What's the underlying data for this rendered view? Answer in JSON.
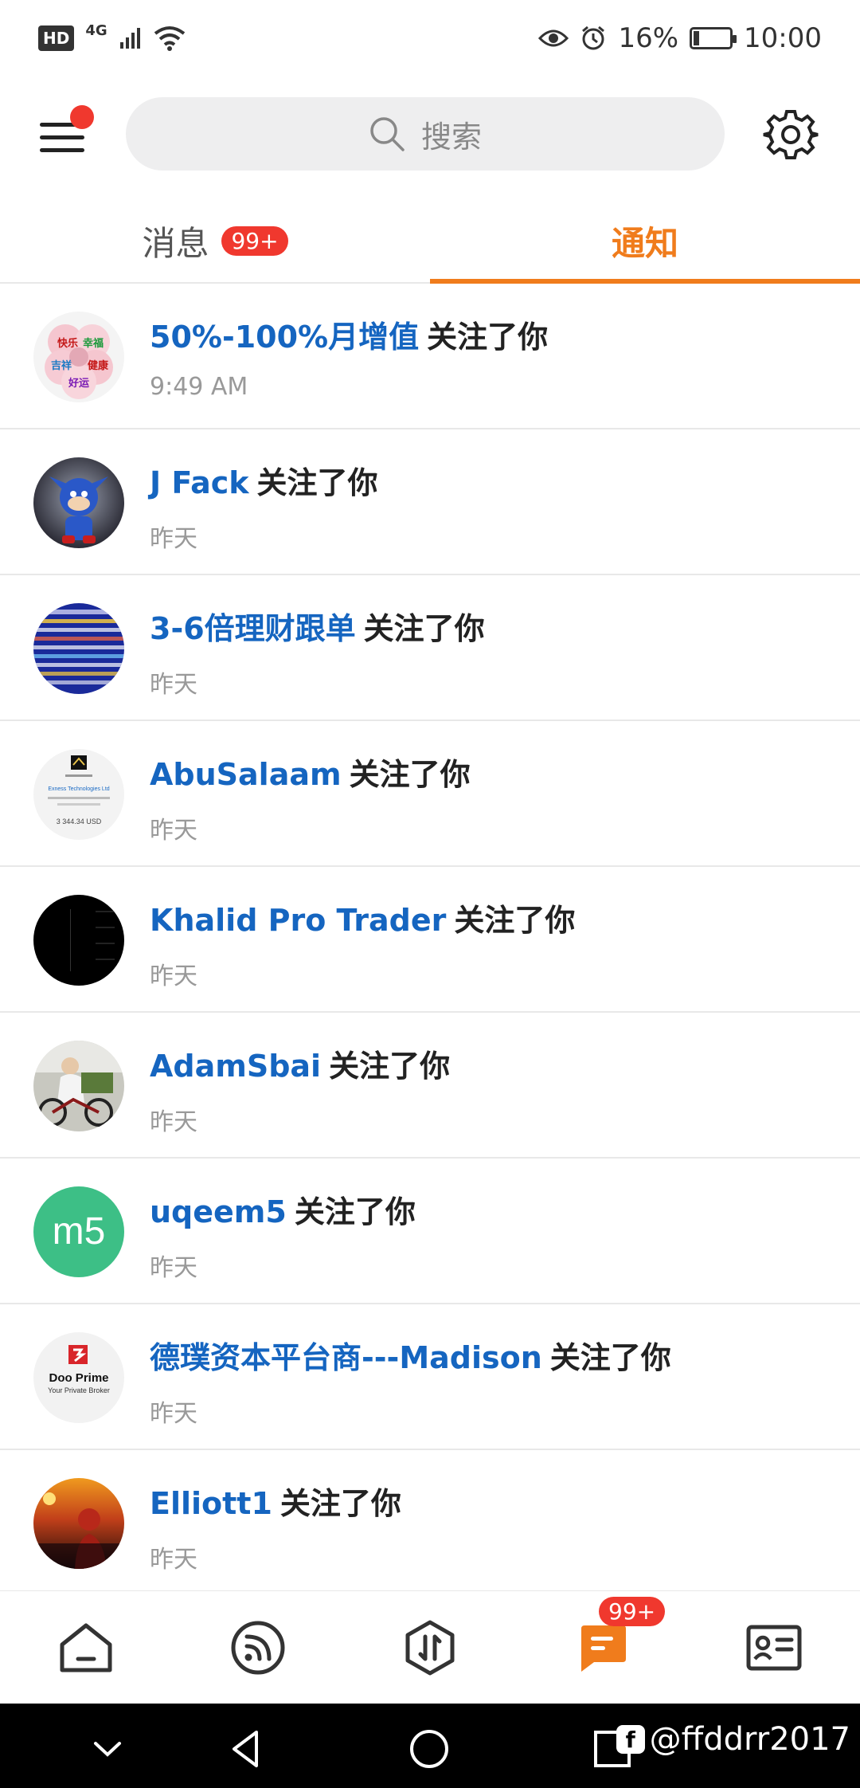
{
  "status_bar": {
    "hd": "HD",
    "network": "4G",
    "battery": "16%",
    "time": "10:00"
  },
  "header": {
    "search_placeholder": "搜索"
  },
  "tabs": [
    {
      "label": "消息",
      "badge": "99+",
      "active": false
    },
    {
      "label": "通知",
      "active": true
    }
  ],
  "notifications": [
    {
      "name": "50%-100%月增值",
      "action": "关注了你",
      "time": "9:49 AM",
      "avatar_labels": [
        "快乐",
        "幸福",
        "吉祥",
        "健康",
        "好运"
      ]
    },
    {
      "name": "J Fack",
      "action": "关注了你",
      "time": "昨天"
    },
    {
      "name": "3-6倍理财跟单",
      "action": "关注了你",
      "time": "昨天"
    },
    {
      "name": "AbuSalaam",
      "action": "关注了你",
      "time": "昨天",
      "avatar_labels": [
        "Exness Technologies Ltd",
        "3 344.34 USD"
      ]
    },
    {
      "name": "Khalid Pro Trader",
      "action": "关注了你",
      "time": "昨天"
    },
    {
      "name": "AdamSbai",
      "action": "关注了你",
      "time": "昨天"
    },
    {
      "name": "uqeem5",
      "action": "关注了你",
      "time": "昨天",
      "avatar_text": "m5"
    },
    {
      "name": "德璞资本平台商---Madison",
      "action": "关注了你",
      "time": "昨天",
      "avatar_labels": [
        "Doo Prime",
        "Your Private Broker"
      ]
    },
    {
      "name": "Elliott1",
      "action": "关注了你",
      "time": "昨天"
    }
  ],
  "bottom_nav": {
    "active": "messages",
    "messages_badge": "99+"
  },
  "watermark": "@ffddrr2017",
  "colors": {
    "accent": "#f07c1c",
    "link": "#1565c0",
    "badge": "#f0382e"
  }
}
